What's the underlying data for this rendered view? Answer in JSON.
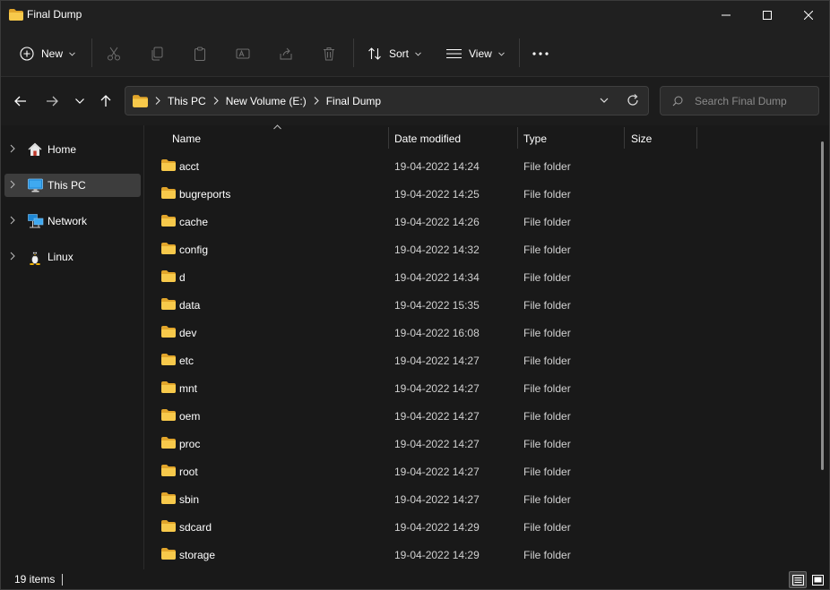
{
  "window": {
    "title": "Final Dump",
    "minimize_icon": "minimize-icon",
    "maximize_icon": "maximize-icon",
    "close_icon": "close-icon"
  },
  "toolbar": {
    "new_label": "New",
    "sort_label": "Sort",
    "view_label": "View",
    "more_icon": "more-icon"
  },
  "address": {
    "crumbs": [
      "This PC",
      "New Volume (E:)",
      "Final Dump"
    ]
  },
  "search": {
    "placeholder": "Search Final Dump"
  },
  "sidebar": {
    "items": [
      {
        "label": "Home",
        "icon": "home-icon"
      },
      {
        "label": "This PC",
        "icon": "computer-icon",
        "selected": true
      },
      {
        "label": "Network",
        "icon": "network-icon"
      },
      {
        "label": "Linux",
        "icon": "linux-icon"
      }
    ]
  },
  "columns": {
    "name": "Name",
    "date": "Date modified",
    "type": "Type",
    "size": "Size"
  },
  "files": [
    {
      "name": "acct",
      "date": "19-04-2022 14:24",
      "type": "File folder",
      "size": ""
    },
    {
      "name": "bugreports",
      "date": "19-04-2022 14:25",
      "type": "File folder",
      "size": ""
    },
    {
      "name": "cache",
      "date": "19-04-2022 14:26",
      "type": "File folder",
      "size": ""
    },
    {
      "name": "config",
      "date": "19-04-2022 14:32",
      "type": "File folder",
      "size": ""
    },
    {
      "name": "d",
      "date": "19-04-2022 14:34",
      "type": "File folder",
      "size": ""
    },
    {
      "name": "data",
      "date": "19-04-2022 15:35",
      "type": "File folder",
      "size": ""
    },
    {
      "name": "dev",
      "date": "19-04-2022 16:08",
      "type": "File folder",
      "size": ""
    },
    {
      "name": "etc",
      "date": "19-04-2022 14:27",
      "type": "File folder",
      "size": ""
    },
    {
      "name": "mnt",
      "date": "19-04-2022 14:27",
      "type": "File folder",
      "size": ""
    },
    {
      "name": "oem",
      "date": "19-04-2022 14:27",
      "type": "File folder",
      "size": ""
    },
    {
      "name": "proc",
      "date": "19-04-2022 14:27",
      "type": "File folder",
      "size": ""
    },
    {
      "name": "root",
      "date": "19-04-2022 14:27",
      "type": "File folder",
      "size": ""
    },
    {
      "name": "sbin",
      "date": "19-04-2022 14:27",
      "type": "File folder",
      "size": ""
    },
    {
      "name": "sdcard",
      "date": "19-04-2022 14:29",
      "type": "File folder",
      "size": ""
    },
    {
      "name": "storage",
      "date": "19-04-2022 14:29",
      "type": "File folder",
      "size": ""
    }
  ],
  "status": {
    "item_count": "19 items"
  },
  "colors": {
    "folder": "#f7c94b",
    "folder_dark": "#e1a52b",
    "background": "#191919",
    "selection": "#3d3d3d"
  }
}
